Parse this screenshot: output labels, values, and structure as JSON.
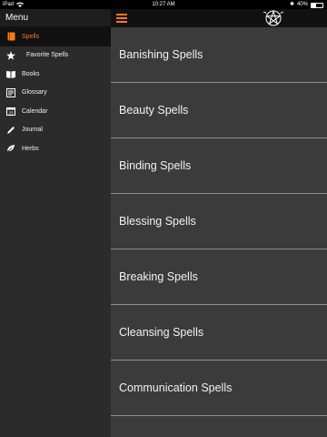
{
  "status_bar": {
    "device": "iPad",
    "time": "10:27 AM",
    "battery": "40%"
  },
  "sidebar": {
    "title": "Menu",
    "items": [
      {
        "label": "Spells",
        "icon": "book-icon",
        "active": true
      },
      {
        "label": "Favorite Spells",
        "icon": "star-icon",
        "active": false
      },
      {
        "label": "Books",
        "icon": "open-book-icon",
        "active": false
      },
      {
        "label": "Glossary",
        "icon": "glossary-icon",
        "active": false
      },
      {
        "label": "Calendar",
        "icon": "calendar-icon",
        "active": false
      },
      {
        "label": "Journal",
        "icon": "pen-icon",
        "active": false
      },
      {
        "label": "Herbs",
        "icon": "leaf-icon",
        "active": false
      }
    ]
  },
  "topbar": {
    "menu_icon": "hamburger-icon",
    "logo_icon": "pentacle-icon"
  },
  "spell_list": [
    "Banishing Spells",
    "Beauty Spells",
    "Binding Spells",
    "Blessing Spells",
    "Breaking Spells",
    "Cleansing Spells",
    "Communication Spells"
  ],
  "colors": {
    "accent": "#ff7a1a",
    "sidebar_bg": "#2b2b2b",
    "main_bg": "#3b3b3b",
    "topbar_bg": "#111111"
  }
}
